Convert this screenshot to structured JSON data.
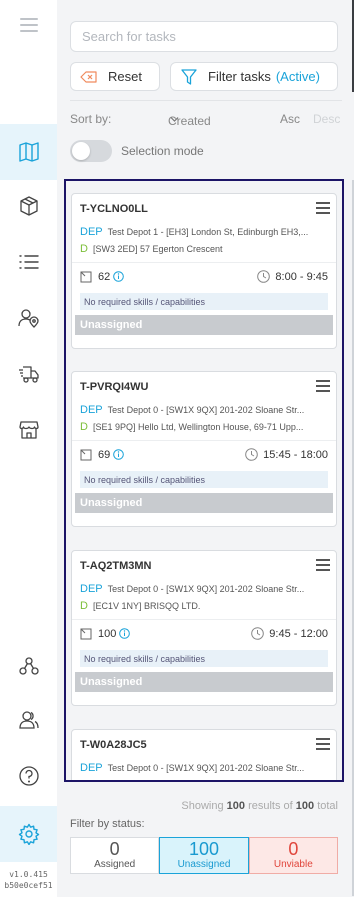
{
  "search": {
    "placeholder": "Search for tasks"
  },
  "toolbar": {
    "reset_label": "Reset",
    "filter_label": "Filter tasks",
    "filter_active": "(Active)"
  },
  "sort": {
    "label": "Sort by:",
    "field": "Created",
    "asc": "Asc",
    "desc": "Desc"
  },
  "selection": {
    "label": "Selection mode",
    "on": false
  },
  "tasks": [
    {
      "id": "T-YCLNO0LL",
      "dep_tag": "DEP",
      "dep": "Test Depot 1 - [EH3] London St, Edinburgh EH3,...",
      "d_tag": "D",
      "d": "[SW3 2ED] 57 Egerton Crescent",
      "capacity": "62",
      "time": "8:00 - 9:45",
      "skills": "No required skills / capabilities",
      "status": "Unassigned"
    },
    {
      "id": "T-PVRQI4WU",
      "dep_tag": "DEP",
      "dep": "Test Depot 0 - [SW1X 9QX] 201-202 Sloane Str...",
      "d_tag": "D",
      "d": "[SE1 9PQ] Hello Ltd, Wellington House, 69-71 Upp...",
      "capacity": "69",
      "time": "15:45 - 18:00",
      "skills": "No required skills / capabilities",
      "status": "Unassigned"
    },
    {
      "id": "T-AQ2TM3MN",
      "dep_tag": "DEP",
      "dep": "Test Depot 0 - [SW1X 9QX] 201-202 Sloane Str...",
      "d_tag": "D",
      "d": "[EC1V 1NY] BRISQQ LTD.",
      "capacity": "100",
      "time": "9:45 - 12:00",
      "skills": "No required skills / capabilities",
      "status": "Unassigned"
    },
    {
      "id": "T-W0A28JC5",
      "dep_tag": "DEP",
      "dep": "Test Depot 0 - [SW1X 9QX] 201-202 Sloane Str..."
    }
  ],
  "results": {
    "prefix": "Showing",
    "shown": "100",
    "middle": "results of",
    "total": "100",
    "suffix": "total"
  },
  "status_filter": {
    "label": "Filter by status:",
    "assigned": {
      "count": "0",
      "label": "Assigned"
    },
    "unassigned": {
      "count": "100",
      "label": "Unassigned"
    },
    "unviable": {
      "count": "0",
      "label": "Unviable"
    }
  },
  "version": {
    "number": "v1.0.415",
    "hash": "b50e0cef51"
  },
  "colors": {
    "accent": "#1aa3d9",
    "border_highlight": "#1c1466",
    "danger": "#e0453b"
  },
  "icons": [
    "menu-icon",
    "map-icon",
    "box-icon",
    "list-icon",
    "driver-location-icon",
    "vehicles-icon",
    "store-icon",
    "network-icon",
    "users-icon",
    "help-icon",
    "settings-icon"
  ]
}
